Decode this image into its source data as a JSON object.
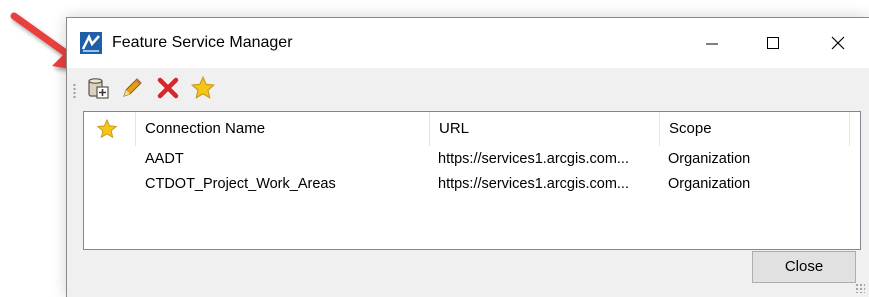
{
  "window": {
    "title": "Feature Service Manager",
    "icon": "feature-service-app-icon"
  },
  "toolbar": {
    "items": [
      {
        "name": "add-connection",
        "icon": "database-add-icon"
      },
      {
        "name": "edit-connection",
        "icon": "pencil-icon"
      },
      {
        "name": "delete-connection",
        "icon": "red-x-icon"
      },
      {
        "name": "favorite-connection",
        "icon": "star-icon"
      }
    ]
  },
  "table": {
    "columns": {
      "favorite_icon": "star-icon",
      "name": "Connection Name",
      "url": "URL",
      "scope": "Scope"
    },
    "rows": [
      {
        "name": "AADT",
        "url": "https://services1.arcgis.com...",
        "scope": "Organization"
      },
      {
        "name": "CTDOT_Project_Work_Areas",
        "url": "https://services1.arcgis.com...",
        "scope": "Organization"
      }
    ]
  },
  "buttons": {
    "close_label": "Close"
  },
  "annotation": {
    "arrow_color": "#e8413c"
  },
  "colors": {
    "star": "#f5c518",
    "delete": "#d8262c",
    "pencil": "#e3a014"
  }
}
